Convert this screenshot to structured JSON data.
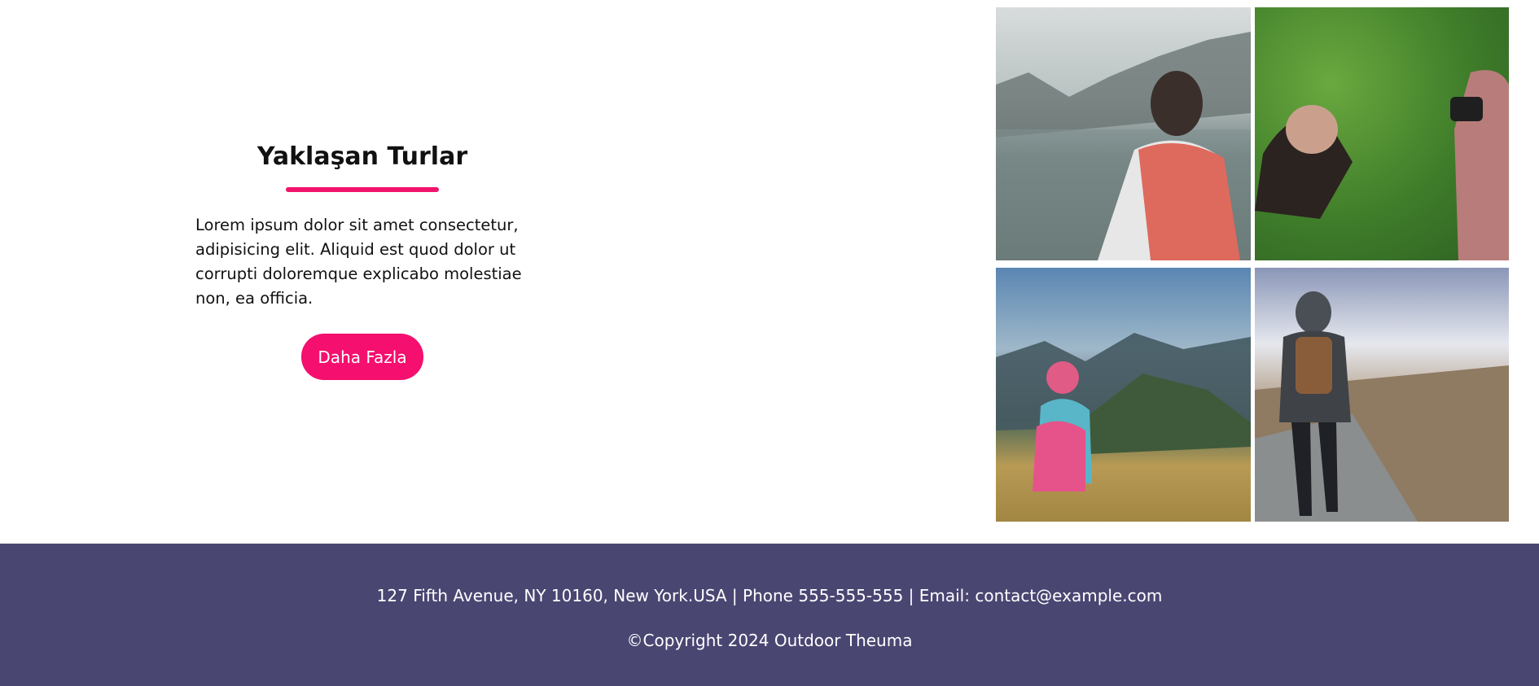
{
  "section": {
    "title": "Yaklaşan Turlar",
    "description": "Lorem ipsum dolor sit amet consectetur, adipisicing elit. Aliquid est quod dolor ut corrupti doloremque explicabo molestiae non, ea officia.",
    "button_label": "Daha Fazla"
  },
  "colors": {
    "accent": "#f0146c",
    "footer_bg": "#4a4672"
  },
  "gallery": [
    {
      "name": "hiker-backpack-lake-photo"
    },
    {
      "name": "photographers-on-grass-photo"
    },
    {
      "name": "girl-sitting-mountain-view-photo"
    },
    {
      "name": "hiker-walking-rocky-trail-photo"
    }
  ],
  "footer": {
    "contact": "127 Fifth Avenue, NY 10160, New York.USA | Phone 555-555-555 | Email: contact@example.com",
    "copyright": "©Copyright 2024 Outdoor Theuma"
  }
}
